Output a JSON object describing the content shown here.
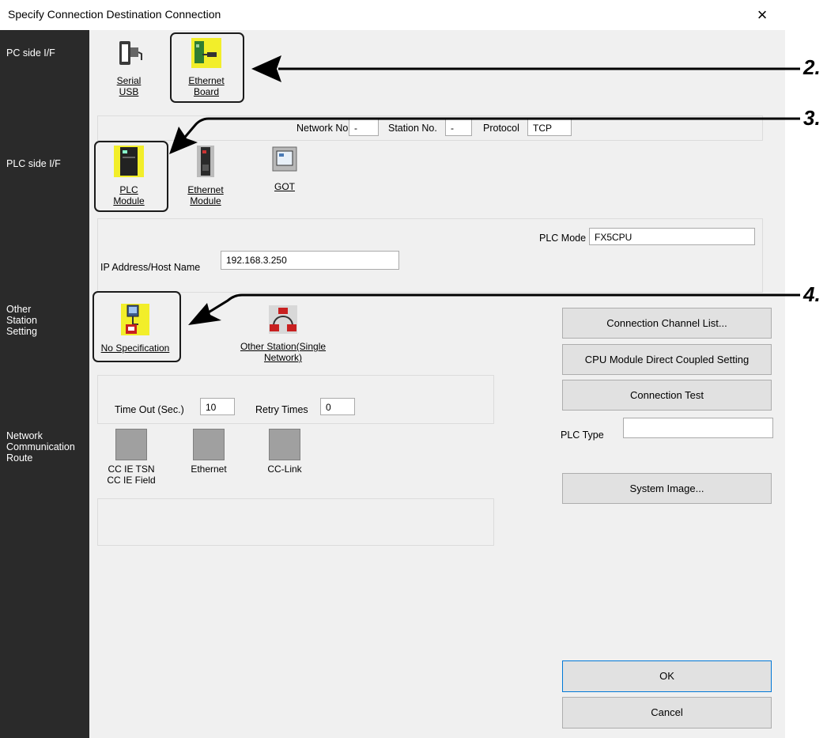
{
  "window": {
    "title": "Specify Connection Destination Connection",
    "close_glyph": "×"
  },
  "sidebar": {
    "pc_side": "PC side I/F",
    "plc_side": "PLC side I/F",
    "other_station": [
      "Other",
      "Station",
      "Setting"
    ],
    "network_route": [
      "Network",
      "Communication",
      "Route"
    ]
  },
  "pc_side": {
    "serial": [
      "Serial",
      "USB"
    ],
    "ethernet_board": [
      "Ethernet",
      "Board"
    ]
  },
  "network_info": {
    "network_no_label": "Network No.",
    "network_no_value": "-",
    "station_no_label": "Station No.",
    "station_no_value": "-",
    "protocol_label": "Protocol",
    "protocol_value": "TCP"
  },
  "plc_side": {
    "plc_module": [
      "PLC",
      "Module"
    ],
    "ethernet_module": [
      "Ethernet",
      "Module"
    ],
    "got": "GOT"
  },
  "plc_details": {
    "plc_mode_label": "PLC Mode",
    "plc_mode_value": "FX5CPU",
    "ip_label": "IP Address/Host Name",
    "ip_value": "192.168.3.250"
  },
  "other_station": {
    "no_specification": "No Specification",
    "other_single": [
      "Other Station(Single ",
      "Network)"
    ]
  },
  "timeout": {
    "timeout_label": "Time Out (Sec.)",
    "timeout_value": "10",
    "retry_label": "Retry Times",
    "retry_value": "0"
  },
  "route": {
    "items": [
      {
        "label": [
          "CC IE TSN",
          "CC IE Field"
        ]
      },
      {
        "label": [
          "Ethernet"
        ]
      },
      {
        "label": [
          "CC-Link"
        ]
      }
    ]
  },
  "buttons": {
    "channel_list": "Connection Channel List...",
    "cpu_direct": "CPU Module Direct Coupled Setting",
    "connection_test": "Connection Test",
    "plc_type_label": "PLC Type",
    "plc_type_value": "",
    "system_image": "System Image...",
    "ok": "OK",
    "cancel": "Cancel"
  },
  "annotations": {
    "step2": "2.",
    "step3": "3.",
    "step4": "4."
  },
  "colors": {
    "accent": "#0078d7",
    "sidebar": "#2a2a2a",
    "icon_yellow": "#f2ee2a",
    "highlight": "#1b1b1b"
  }
}
